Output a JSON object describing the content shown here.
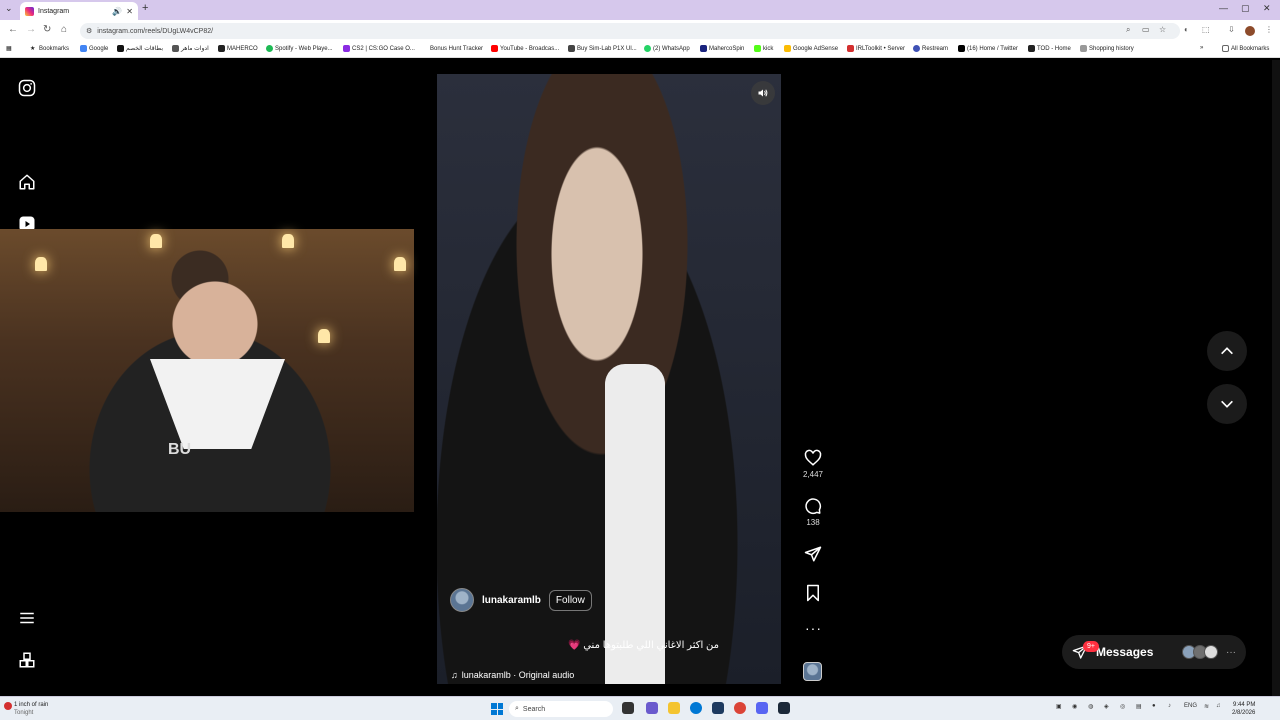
{
  "browser": {
    "tab_title": "Instagram",
    "url": "instagram.com/reels/DUgLW4vCP82/",
    "bookmarks": [
      {
        "label": "Bookmarks",
        "color": "#333333"
      },
      {
        "label": "Google",
        "color": "#4285f4"
      },
      {
        "label": "بطاقات الخصم",
        "color": "#111111"
      },
      {
        "label": "ادوات ماهر",
        "color": "#555555"
      },
      {
        "label": "MAHERCO",
        "color": "#222222"
      },
      {
        "label": "Spotify - Web Playe...",
        "color": "#1db954"
      },
      {
        "label": "CS2 | CS:GO Case O...",
        "color": "#8a2be2"
      },
      {
        "label": "Bonus Hunt Tracker",
        "color": "#ffffff"
      },
      {
        "label": "YouTube - Broadcas...",
        "color": "#ff0000"
      },
      {
        "label": "Buy Sim-Lab P1X Ul...",
        "color": "#444444"
      },
      {
        "label": "(2) WhatsApp",
        "color": "#25d366"
      },
      {
        "label": "MahercoSpin",
        "color": "#1a237e"
      },
      {
        "label": "kick",
        "color": "#53fc18"
      },
      {
        "label": "Google AdSense",
        "color": "#fbbc04"
      },
      {
        "label": "IRLToolkit • Server",
        "color": "#d32f2f"
      },
      {
        "label": "Restream",
        "color": "#3f51b5"
      },
      {
        "label": "(16) Home / Twitter",
        "color": "#000000"
      },
      {
        "label": "TOD - Home",
        "color": "#222222"
      },
      {
        "label": "Shopping history",
        "color": "#999999"
      }
    ],
    "all_bookmarks": "All Bookmarks"
  },
  "sidebar": {
    "icons": [
      "instagram-logo-icon",
      "home-icon",
      "reels-icon",
      "menu-icon",
      "more-apps-icon"
    ]
  },
  "webcam": {
    "shirt_text": "BU"
  },
  "reel": {
    "username": "lunakaramlb",
    "follow_label": "Follow",
    "caption": "من اكثر الاغاني اللي طلبتوها مني 💗",
    "audio": "lunakaramlb · Original audio",
    "likes": "2,447",
    "comments": "138"
  },
  "messages": {
    "label": "Messages",
    "badge": "9+"
  },
  "taskbar": {
    "weather_title": "1 inch of rain",
    "weather_sub": "Tonight",
    "search_placeholder": "Search",
    "language": "ENG",
    "time": "9:44 PM",
    "date": "2/8/2026"
  }
}
